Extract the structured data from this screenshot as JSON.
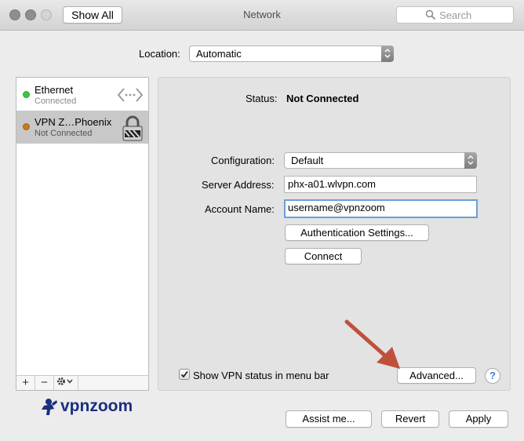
{
  "window": {
    "title": "Network",
    "show_all_label": "Show All",
    "search_placeholder": "Search"
  },
  "location": {
    "label": "Location:",
    "value": "Automatic"
  },
  "services": [
    {
      "name": "Ethernet",
      "status": "Connected",
      "dot_color": "#3fc43f",
      "icon": "ethernet-arrows-icon",
      "selected": false
    },
    {
      "name": "VPN Z…Phoenix",
      "status": "Not Connected",
      "dot_color": "#c77a1e",
      "icon": "vpn-lock-icon",
      "selected": true
    }
  ],
  "list_toolbar": {
    "add": "+",
    "remove": "−",
    "actions_icon": "gear-icon"
  },
  "detail": {
    "status_label": "Status:",
    "status_value": "Not Connected",
    "configuration_label": "Configuration:",
    "configuration_value": "Default",
    "server_address_label": "Server Address:",
    "server_address_value": "phx-a01.wlvpn.com",
    "account_name_label": "Account Name:",
    "account_name_value": "username@vpnzoom",
    "auth_button": "Authentication Settings...",
    "connect_button": "Connect",
    "show_vpn_status_label": "Show VPN status in menu bar",
    "show_vpn_status_checked": true,
    "advanced_button": "Advanced...",
    "help": "?"
  },
  "footer": {
    "assist_button": "Assist me...",
    "revert_button": "Revert",
    "apply_button": "Apply"
  },
  "logo": {
    "part1": "vpn",
    "part2": "zoom",
    "color": "#1b2f7e"
  },
  "annotation_arrow_color": "#c0503c"
}
